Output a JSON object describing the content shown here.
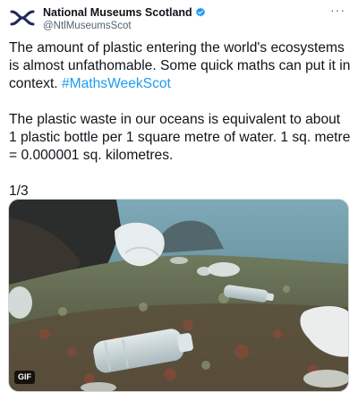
{
  "account": {
    "display_name": "National Museums Scotland",
    "handle": "@NtlMuseumsScot",
    "verified": true,
    "avatar_icon": "nms-logo-icon",
    "verified_icon": "verified-badge-icon"
  },
  "more_label": "···",
  "tweet": {
    "para1_text": "The amount of plastic entering the world's ecosystems is almost unfathomable. Some quick maths can put it in context. ",
    "hashtag": "#MathsWeekScot",
    "para2": "The plastic waste in our oceans is equivalent to about 1 plastic bottle per 1 square metre of water. 1 sq. metre = 0.000001 sq. kilometres.",
    "thread_count": "1/3"
  },
  "media": {
    "badge": "GIF"
  },
  "colors": {
    "accent": "#1d9bf0",
    "verified": "#1d9bf0",
    "text": "#0f1419",
    "secondary": "#536471"
  }
}
